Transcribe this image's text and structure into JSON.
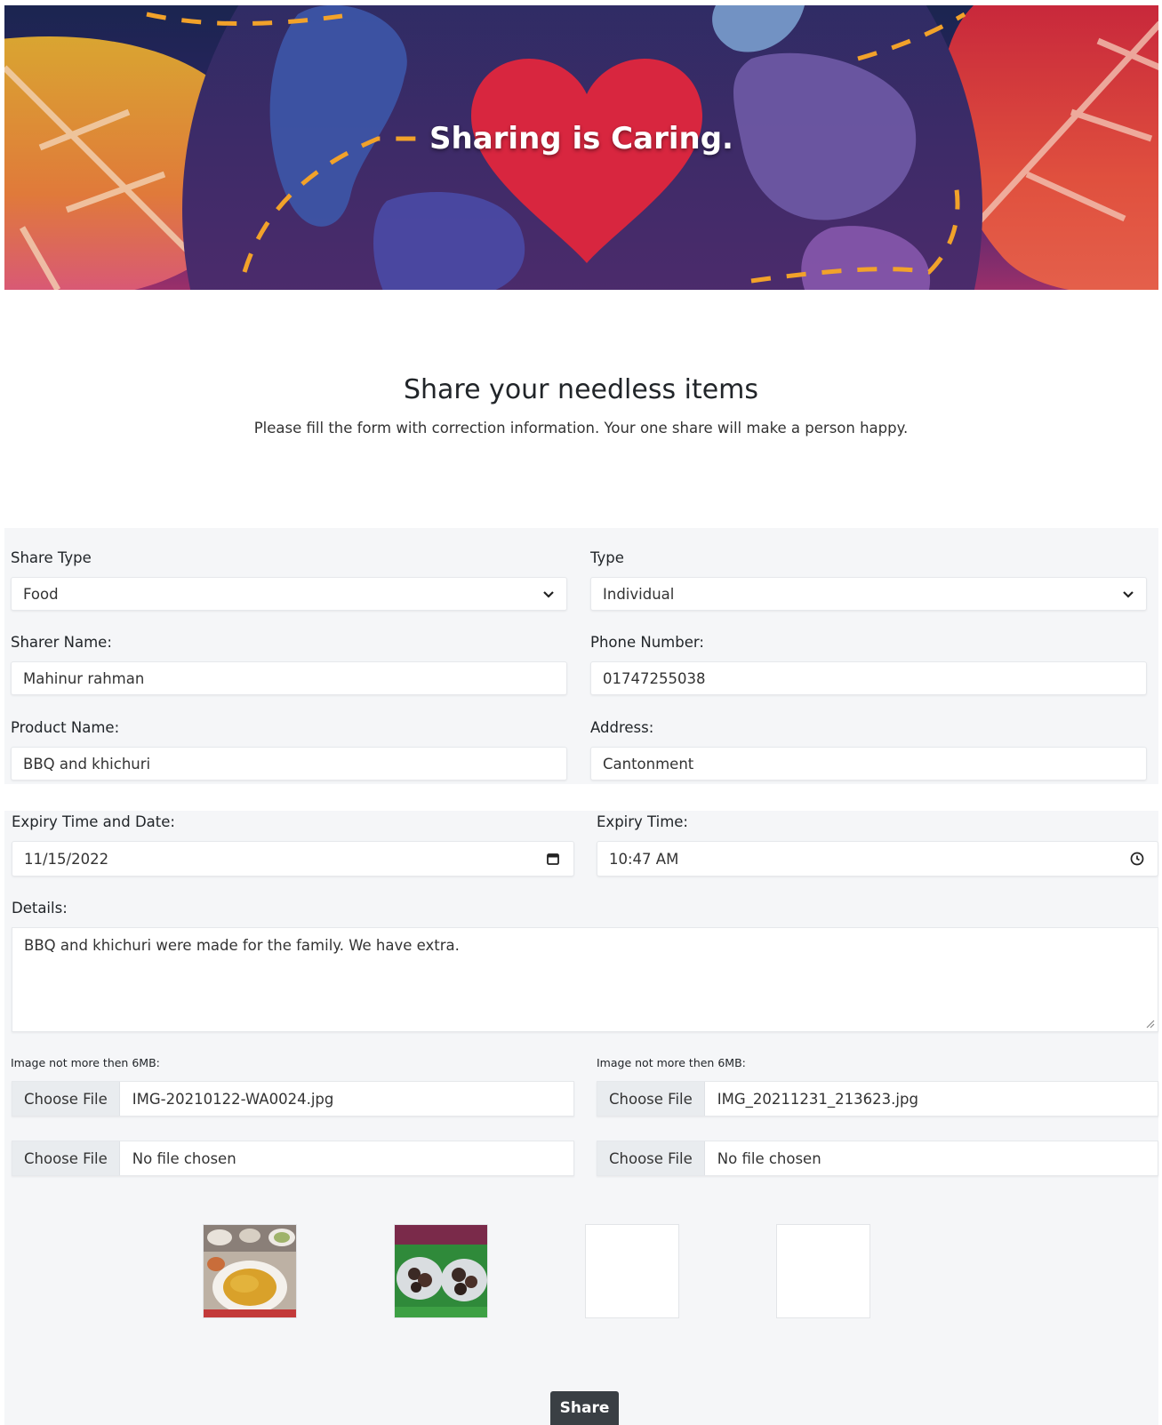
{
  "hero": {
    "title": "Sharing is Caring."
  },
  "intro": {
    "title": "Share your needless items",
    "subtitle": "Please fill the form with correction information. Your one share will make a person happy."
  },
  "form": {
    "share_type": {
      "label": "Share Type",
      "value": "Food"
    },
    "type": {
      "label": "Type",
      "value": "Individual"
    },
    "sharer_name": {
      "label": "Sharer Name:",
      "value": "Mahinur rahman"
    },
    "phone": {
      "label": "Phone Number:",
      "value": "01747255038"
    },
    "product_name": {
      "label": "Product Name:",
      "value": "BBQ and khichuri"
    },
    "address": {
      "label": "Address:",
      "value": "Cantonment"
    },
    "expiry_date": {
      "label": "Expiry Time and Date:",
      "value": "11/15/2022"
    },
    "expiry_time": {
      "label": "Expiry Time:",
      "value": "10:47 AM"
    },
    "details": {
      "label": "Details:",
      "value": "BBQ and khichuri were made for the family. We have extra."
    },
    "image_note_left": "Image not more then 6MB:",
    "image_note_right": "Image not more then 6MB:",
    "files": [
      {
        "button": "Choose File",
        "name": "IMG-20210122-WA0024.jpg"
      },
      {
        "button": "Choose File",
        "name": "IMG_20211231_213623.jpg"
      },
      {
        "button": "Choose File",
        "name": "No file chosen"
      },
      {
        "button": "Choose File",
        "name": "No file chosen"
      }
    ],
    "submit_label": "Share"
  },
  "icons": {
    "select_arrow": "chevron-down-icon",
    "date": "calendar-icon",
    "time": "clock-icon"
  },
  "colors": {
    "panel_bg": "#f5f6f8",
    "button_dark": "#3a3f44",
    "file_button_bg": "#e9ecef"
  }
}
